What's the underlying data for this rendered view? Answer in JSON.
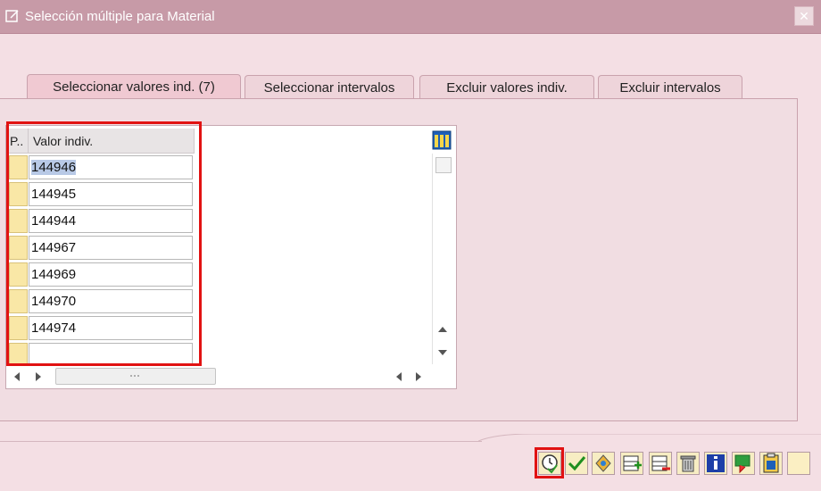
{
  "window": {
    "title": "Selección múltiple para Material",
    "close_glyph": "✕"
  },
  "tabs": [
    {
      "label": "Seleccionar valores ind. (7)",
      "active": true
    },
    {
      "label": "Seleccionar intervalos",
      "active": false
    },
    {
      "label": "Excluir valores indiv.",
      "active": false
    },
    {
      "label": "Excluir intervalos",
      "active": false
    }
  ],
  "table": {
    "headers": {
      "col1": "P..",
      "col2": "Valor indiv."
    },
    "rows": [
      "144946",
      "144945",
      "144944",
      "144967",
      "144969",
      "144970",
      "144974",
      ""
    ]
  },
  "toolbar": {
    "buttons": [
      "clock-execute-icon",
      "check-icon",
      "multi-select-icon",
      "insert-row-icon",
      "delete-row-icon",
      "trash-icon",
      "info-icon",
      "import-icon",
      "clipboard-icon",
      "blank-icon"
    ]
  },
  "colors": {
    "accent_red": "#e11212",
    "titlebar": "#c79aa7",
    "panel": "#f1dde2"
  }
}
